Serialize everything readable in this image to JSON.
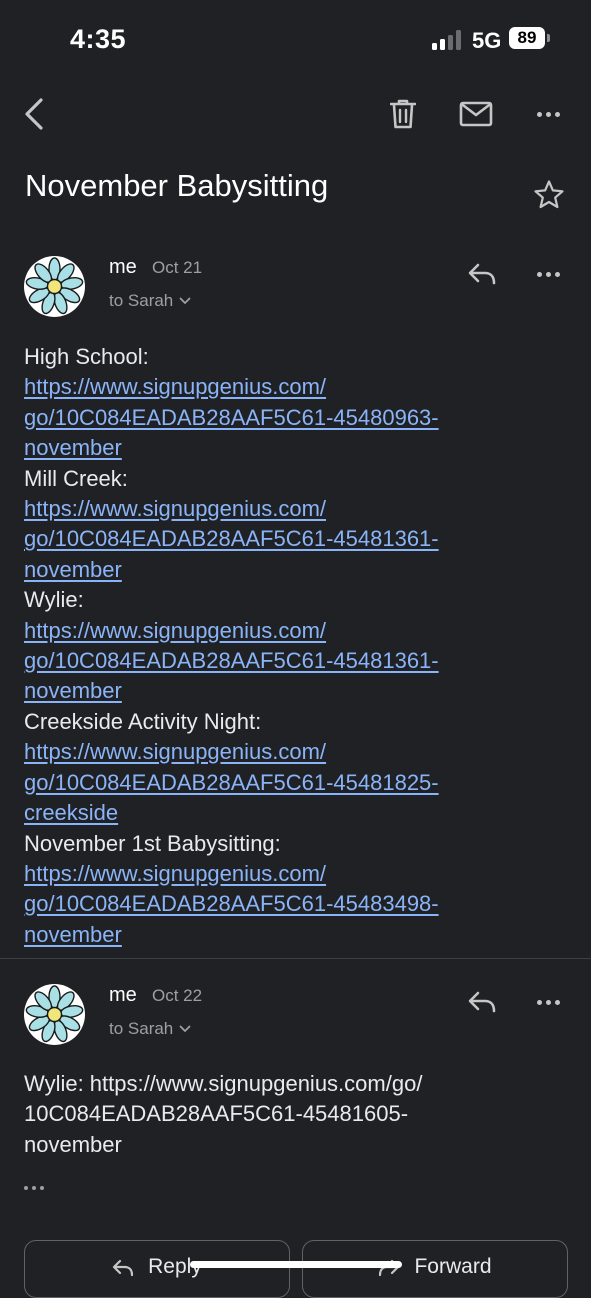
{
  "status_bar": {
    "time": "4:35",
    "network": "5G",
    "battery": "89"
  },
  "app_bar": {
    "back_icon": "chevron-left-icon",
    "delete_icon": "trash-icon",
    "mark_unread_icon": "mail-icon",
    "more_icon": "more-horizontal-icon"
  },
  "subject": "November Babysitting",
  "messages": [
    {
      "sender": "me",
      "date": "Oct 21",
      "recipient": "to Sarah",
      "lines": [
        {
          "type": "text",
          "text": "High School:"
        },
        {
          "type": "link",
          "text": "https://www.signupgenius.com/"
        },
        {
          "type": "link",
          "text": "go/10C084EADAB28AAF5C61-45480963-"
        },
        {
          "type": "link",
          "text": "november"
        },
        {
          "type": "text",
          "text": "Mill Creek:"
        },
        {
          "type": "link",
          "text": "https://www.signupgenius.com/"
        },
        {
          "type": "link",
          "text": "go/10C084EADAB28AAF5C61-45481361-"
        },
        {
          "type": "link",
          "text": "november"
        },
        {
          "type": "text",
          "text": "Wylie:"
        },
        {
          "type": "link",
          "text": "https://www.signupgenius.com/"
        },
        {
          "type": "link",
          "text": "go/10C084EADAB28AAF5C61-45481361-"
        },
        {
          "type": "link",
          "text": "november"
        },
        {
          "type": "text",
          "text": "Creekside Activity Night:"
        },
        {
          "type": "link",
          "text": "https://www.signupgenius.com/"
        },
        {
          "type": "link",
          "text": "go/10C084EADAB28AAF5C61-45481825-"
        },
        {
          "type": "link",
          "text": "creekside"
        },
        {
          "type": "text",
          "text": "November 1st Babysitting:"
        },
        {
          "type": "link",
          "text": "https://www.signupgenius.com/"
        },
        {
          "type": "link",
          "text": "go/10C084EADAB28AAF5C61-45483498-"
        },
        {
          "type": "link",
          "text": "november"
        }
      ]
    },
    {
      "sender": "me",
      "date": "Oct 22",
      "recipient": "to Sarah",
      "lines": [
        {
          "type": "text",
          "text": "Wylie: https://www.signupgenius.com/go/"
        },
        {
          "type": "text",
          "text": "10C084EADAB28AAF5C61-45481605-"
        },
        {
          "type": "text",
          "text": "november"
        }
      ]
    }
  ],
  "actions": {
    "reply_label": "Reply",
    "forward_label": "Forward"
  },
  "colors": {
    "background": "#202124",
    "link": "#8ab4f8",
    "secondary_text": "#9aa0a6",
    "avatar_petals": "#a8e0e6"
  }
}
